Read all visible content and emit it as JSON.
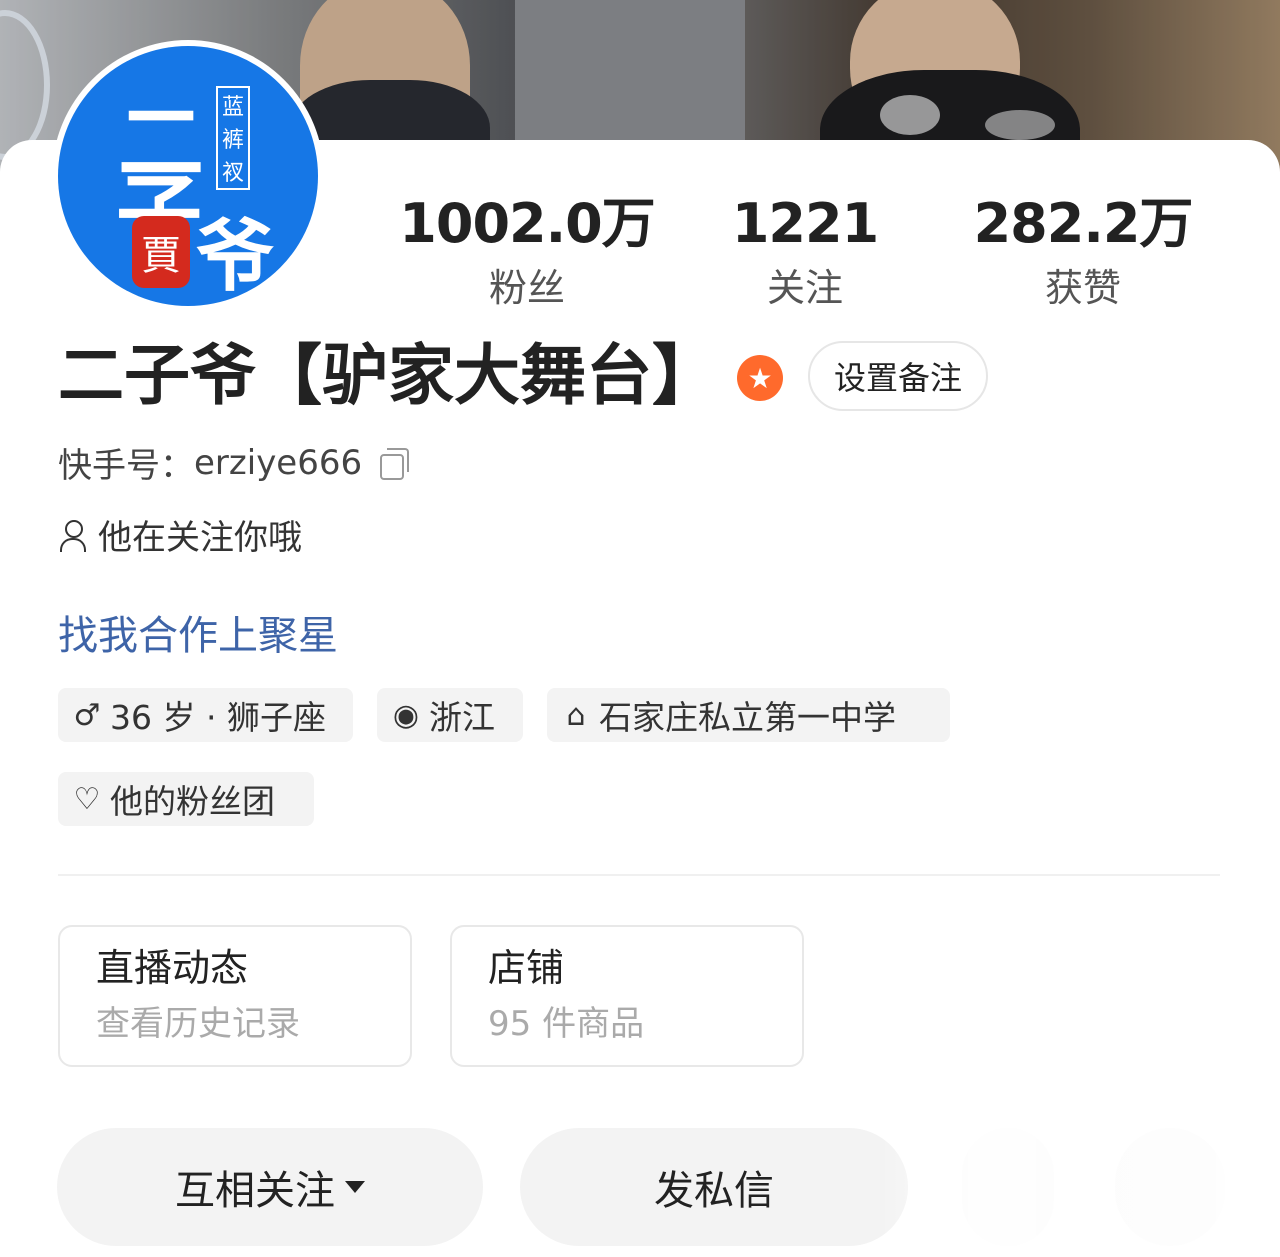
{
  "avatar": {
    "vertical_text": [
      "蓝",
      "裤",
      "衩"
    ],
    "chars": [
      "二",
      "子",
      "爷"
    ],
    "seal": "賈",
    "bg_color": "#1677e6"
  },
  "stats": {
    "fans": {
      "value": "1002.0万",
      "label": "粉丝"
    },
    "following": {
      "value": "1221",
      "label": "关注"
    },
    "likes": {
      "value": "282.2万",
      "label": "获赞"
    }
  },
  "profile": {
    "name": "二子爷【驴家大舞台】",
    "badge_icon": "star-icon",
    "badge_color": "#ff6a2c",
    "remark_button": "设置备注",
    "id_label": "快手号：",
    "id_value": "erziye666",
    "follows_you": "他在关注你哦",
    "cooperation_link": "找我合作上聚星",
    "link_color": "#3e64a8"
  },
  "tags": {
    "age": "36 岁 · 狮子座",
    "location": "浙江",
    "school": "石家庄私立第一中学",
    "fan_club": "他的粉丝团"
  },
  "cards": {
    "live": {
      "title": "直播动态",
      "subtitle": "查看历史记录"
    },
    "shop": {
      "title": "店铺",
      "subtitle": "95 件商品"
    }
  },
  "actions": {
    "follow": "互相关注",
    "message": "发私信"
  }
}
